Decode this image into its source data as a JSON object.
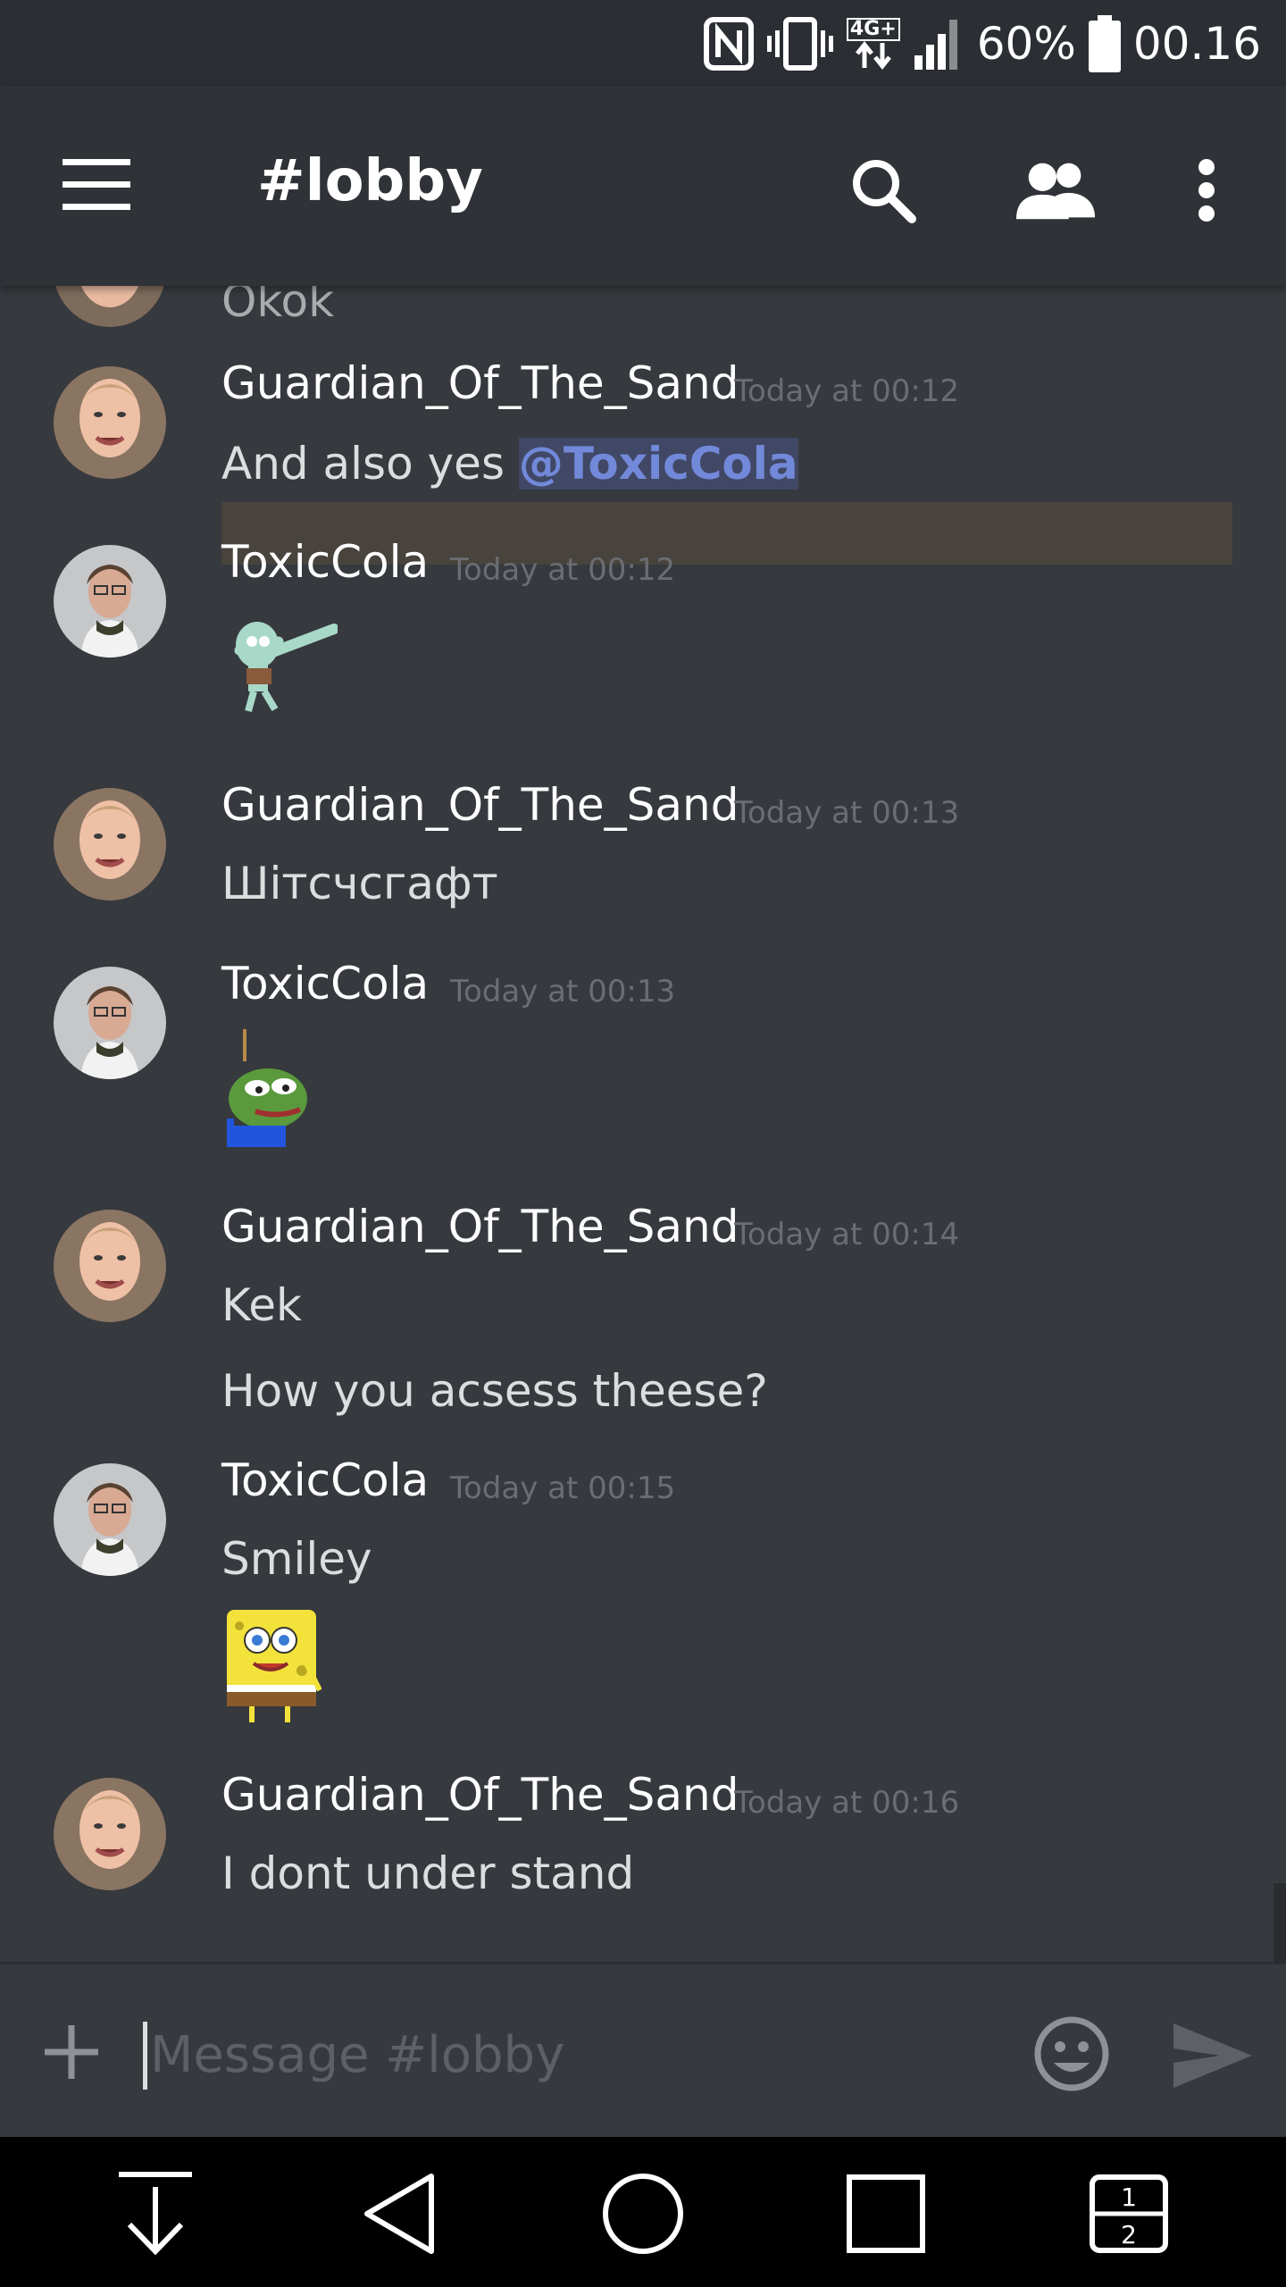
{
  "status_bar": {
    "nfc_icon": "nfc-icon",
    "vibrate_icon": "vibrate-icon",
    "network_label": "4G+",
    "battery_percent": "60%",
    "time": "00.16"
  },
  "app_bar": {
    "title": "#lobby",
    "icons": [
      "hamburger-menu-icon",
      "search-icon",
      "members-icon",
      "overflow-menu-icon"
    ]
  },
  "messages": [
    {
      "partial_text": "Okok"
    },
    {
      "author": "Guardian_Of_The_Sand",
      "timestamp": "Today at 00:12",
      "lines": [
        {
          "text": "And also yes ",
          "mention": "@ToxicCola"
        }
      ]
    },
    {
      "author": "ToxicCola",
      "timestamp": "Today at 00:12",
      "sticker": "squidward-dab-sticker"
    },
    {
      "author": "Guardian_Of_The_Sand",
      "timestamp": "Today at 00:13",
      "lines": [
        {
          "text": "Шітсчсгафт"
        }
      ]
    },
    {
      "author": "ToxicCola",
      "timestamp": "Today at 00:13",
      "sticker": "sad-pepe-frog-sticker"
    },
    {
      "author": "Guardian_Of_The_Sand",
      "timestamp": "Today at 00:14",
      "lines": [
        {
          "text": "Kek"
        },
        {
          "text": "How you acsess theese?"
        }
      ]
    },
    {
      "author": "ToxicCola",
      "timestamp": "Today at 00:15",
      "lines": [
        {
          "text": "Smiley"
        }
      ],
      "sticker": "spongebob-sticker"
    },
    {
      "author": "Guardian_Of_The_Sand",
      "timestamp": "Today at 00:16",
      "lines": [
        {
          "text": "I dont under stand"
        }
      ]
    }
  ],
  "composer": {
    "placeholder": "Message #lobby"
  },
  "nav_bar": {
    "icons": [
      "notification-pull-icon",
      "back-icon",
      "home-icon",
      "recents-icon",
      "dual-window-icon"
    ],
    "dual_window_top": "1",
    "dual_window_bottom": "2"
  },
  "colors": {
    "background": "#36393e",
    "app_bar": "#2f3237",
    "status_bar": "#2b2e33",
    "mention_text": "#7289da",
    "mention_bg": "#414866",
    "highlight_row": "#48443d"
  }
}
